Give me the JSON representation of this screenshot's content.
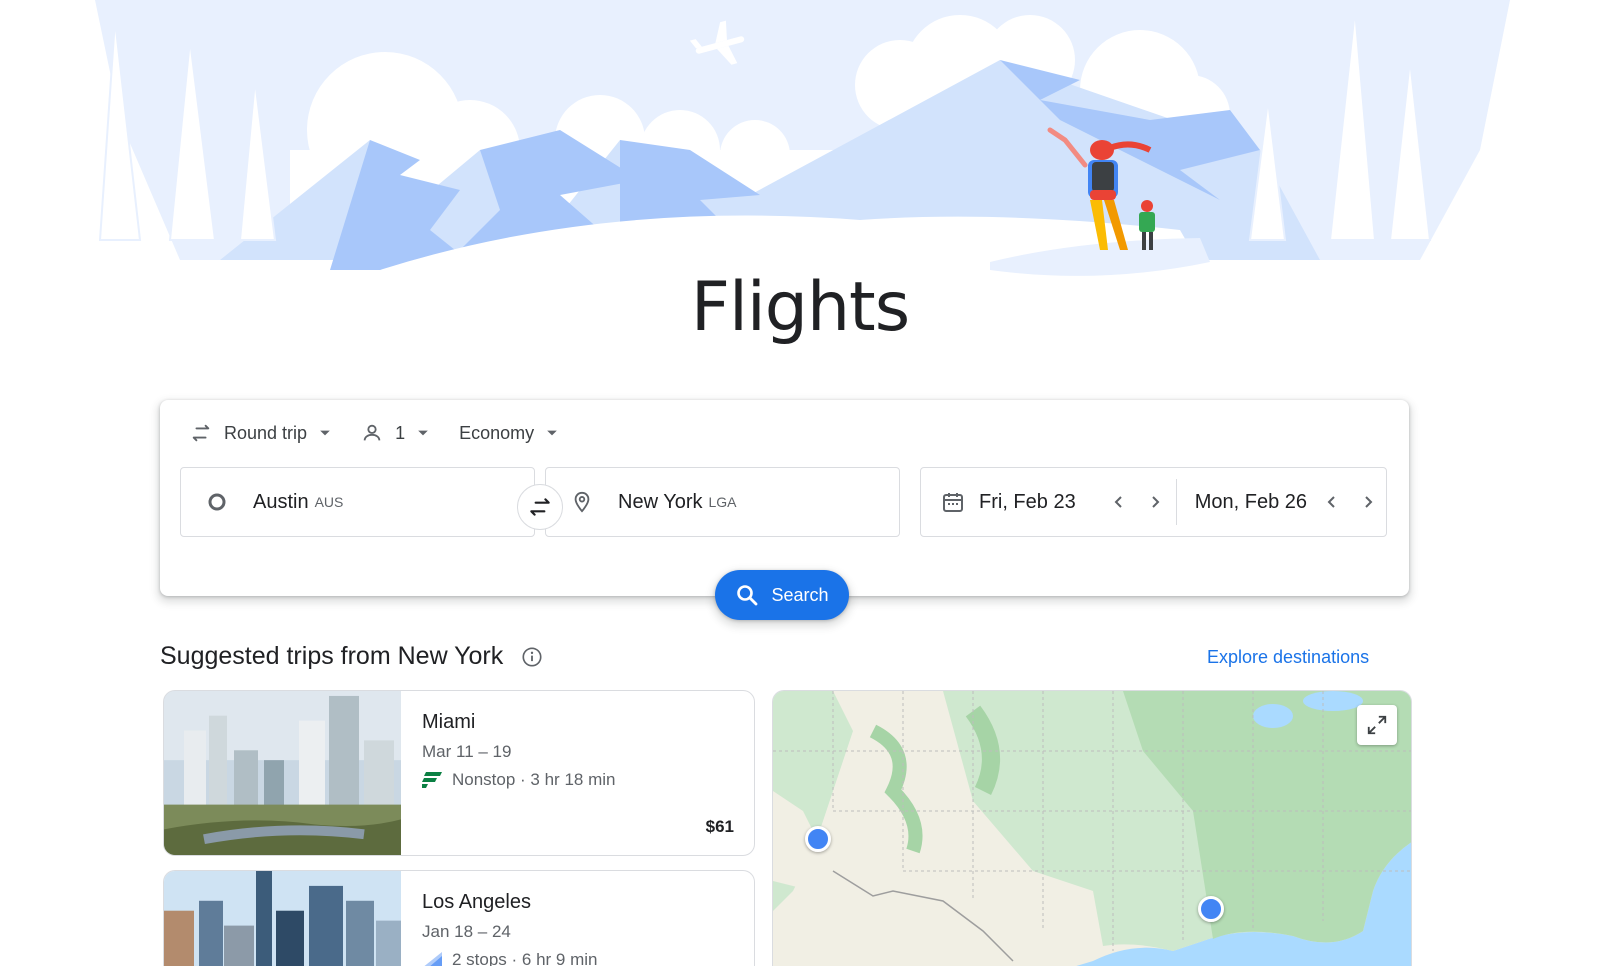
{
  "page_title": "Flights",
  "search": {
    "trip_type": "Round trip",
    "passengers": "1",
    "cabin_class": "Economy",
    "origin": {
      "city": "Austin",
      "code": "AUS"
    },
    "destination": {
      "city": "New York",
      "code": "LGA"
    },
    "depart_date": "Fri, Feb 23",
    "return_date": "Mon, Feb 26",
    "search_label": "Search"
  },
  "suggested": {
    "title": "Suggested trips from New York",
    "explore_label": "Explore destinations",
    "trips": [
      {
        "destination": "Miami",
        "dates": "Mar 11 – 19",
        "info": "Nonstop · 3 hr 18 min",
        "price": "$61"
      },
      {
        "destination": "Los Angeles",
        "dates": "Jan 18 – 24",
        "info": "2 stops · 6 hr 9 min"
      }
    ]
  },
  "colors": {
    "accent": "#1a73e8",
    "sky": "#e8f0fe",
    "mountain": "#a8c7fa",
    "map_land": "#cfe8cf",
    "map_desert": "#f1efe4",
    "pin": "#4285f4"
  }
}
